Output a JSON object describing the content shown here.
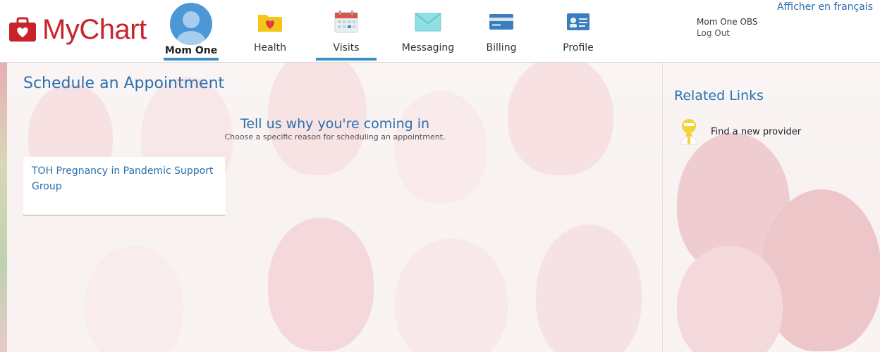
{
  "brand": {
    "name": "MyChart",
    "color": "#c8232c"
  },
  "nav": {
    "user": {
      "label": "Mom One",
      "icon": "user-avatar-icon"
    },
    "items": [
      {
        "label": "Health",
        "icon": "heart-folder-icon"
      },
      {
        "label": "Visits",
        "icon": "calendar-icon",
        "active": true
      },
      {
        "label": "Messaging",
        "icon": "envelope-icon"
      },
      {
        "label": "Billing",
        "icon": "credit-card-icon"
      },
      {
        "label": "Profile",
        "icon": "id-card-icon"
      }
    ],
    "accent": "#3c8fc7"
  },
  "account": {
    "name": "Mom One OBS",
    "logout": "Log Out"
  },
  "language_link": "Afficher en français",
  "main": {
    "title": "Schedule an Appointment",
    "reason_heading": "Tell us why you're coming in",
    "reason_subtext": "Choose a specific reason for scheduling an appointment.",
    "reasons": [
      {
        "label": "TOH Pregnancy in Pandemic Support Group"
      }
    ]
  },
  "sidebar": {
    "title": "Related Links",
    "links": [
      {
        "label": "Find a new provider",
        "icon": "provider-search-icon"
      }
    ]
  },
  "colors": {
    "link_blue": "#2a6fae"
  }
}
